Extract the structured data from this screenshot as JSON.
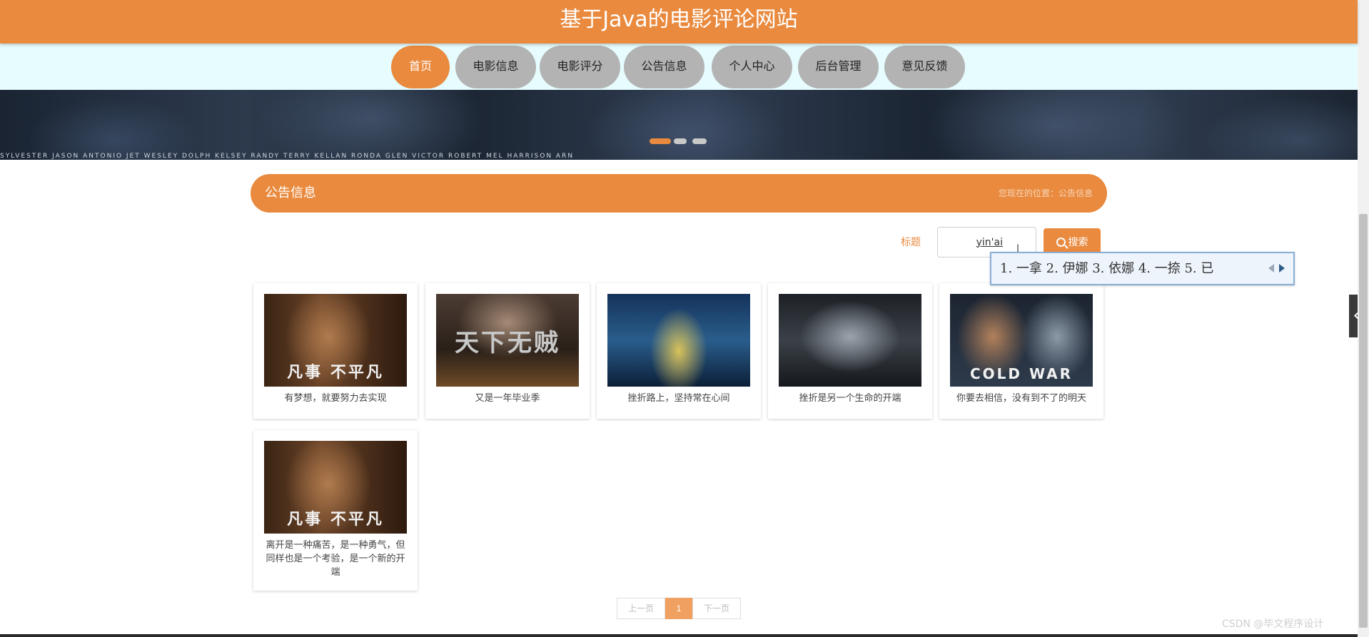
{
  "header": {
    "title": "基于Java的电影评论网站"
  },
  "nav": {
    "items": [
      {
        "label": "首页",
        "active": true
      },
      {
        "label": "电影信息"
      },
      {
        "label": "电影评分"
      },
      {
        "label": "公告信息"
      },
      {
        "label": "个人中心"
      },
      {
        "label": "后台管理"
      },
      {
        "label": "意见反馈"
      }
    ]
  },
  "banner": {
    "cast_names": "SYLVESTER      JASON      ANTONIO      JET      WESLEY      DOLPH      KELSEY      RANDY      TERRY      KELLAN      RONDA      GLEN      VICTOR      ROBERT      MEL      HARRISON      ARN",
    "dot_count": 3,
    "active_dot": 0
  },
  "section": {
    "title": "公告信息",
    "breadcrumb": "您现在的位置：公告信息"
  },
  "search": {
    "label": "标题",
    "value": "yin'ai",
    "button_label": "搜索"
  },
  "ime": {
    "candidates": "1. 一拿  2. 伊娜  3. 依娜  4. 一捺  5. 已"
  },
  "cards": [
    {
      "caption": "有梦想，就要努力去实现",
      "poster_text": "凡事 不平凡"
    },
    {
      "caption": "又是一年毕业季",
      "poster_text": "天下无贼"
    },
    {
      "caption": "挫折路上，坚持常在心间",
      "poster_text": ""
    },
    {
      "caption": "挫折是另一个生命的开端",
      "poster_text": ""
    },
    {
      "caption": "你要去相信，没有到不了的明天",
      "poster_text": "COLD WAR"
    },
    {
      "caption": "离开是一种痛苦，是一种勇气，但同样也是一个考验，是一个新的开端",
      "poster_text": "凡事 不平凡"
    }
  ],
  "pagination": {
    "prev_label": "上一页",
    "current": "1",
    "next_label": "下一页"
  },
  "watermark": "CSDN @毕文程序设计",
  "colors": {
    "accent": "#e98a3e",
    "nav_background": "#e6fcfe",
    "nav_inactive": "#b3b3b3"
  }
}
